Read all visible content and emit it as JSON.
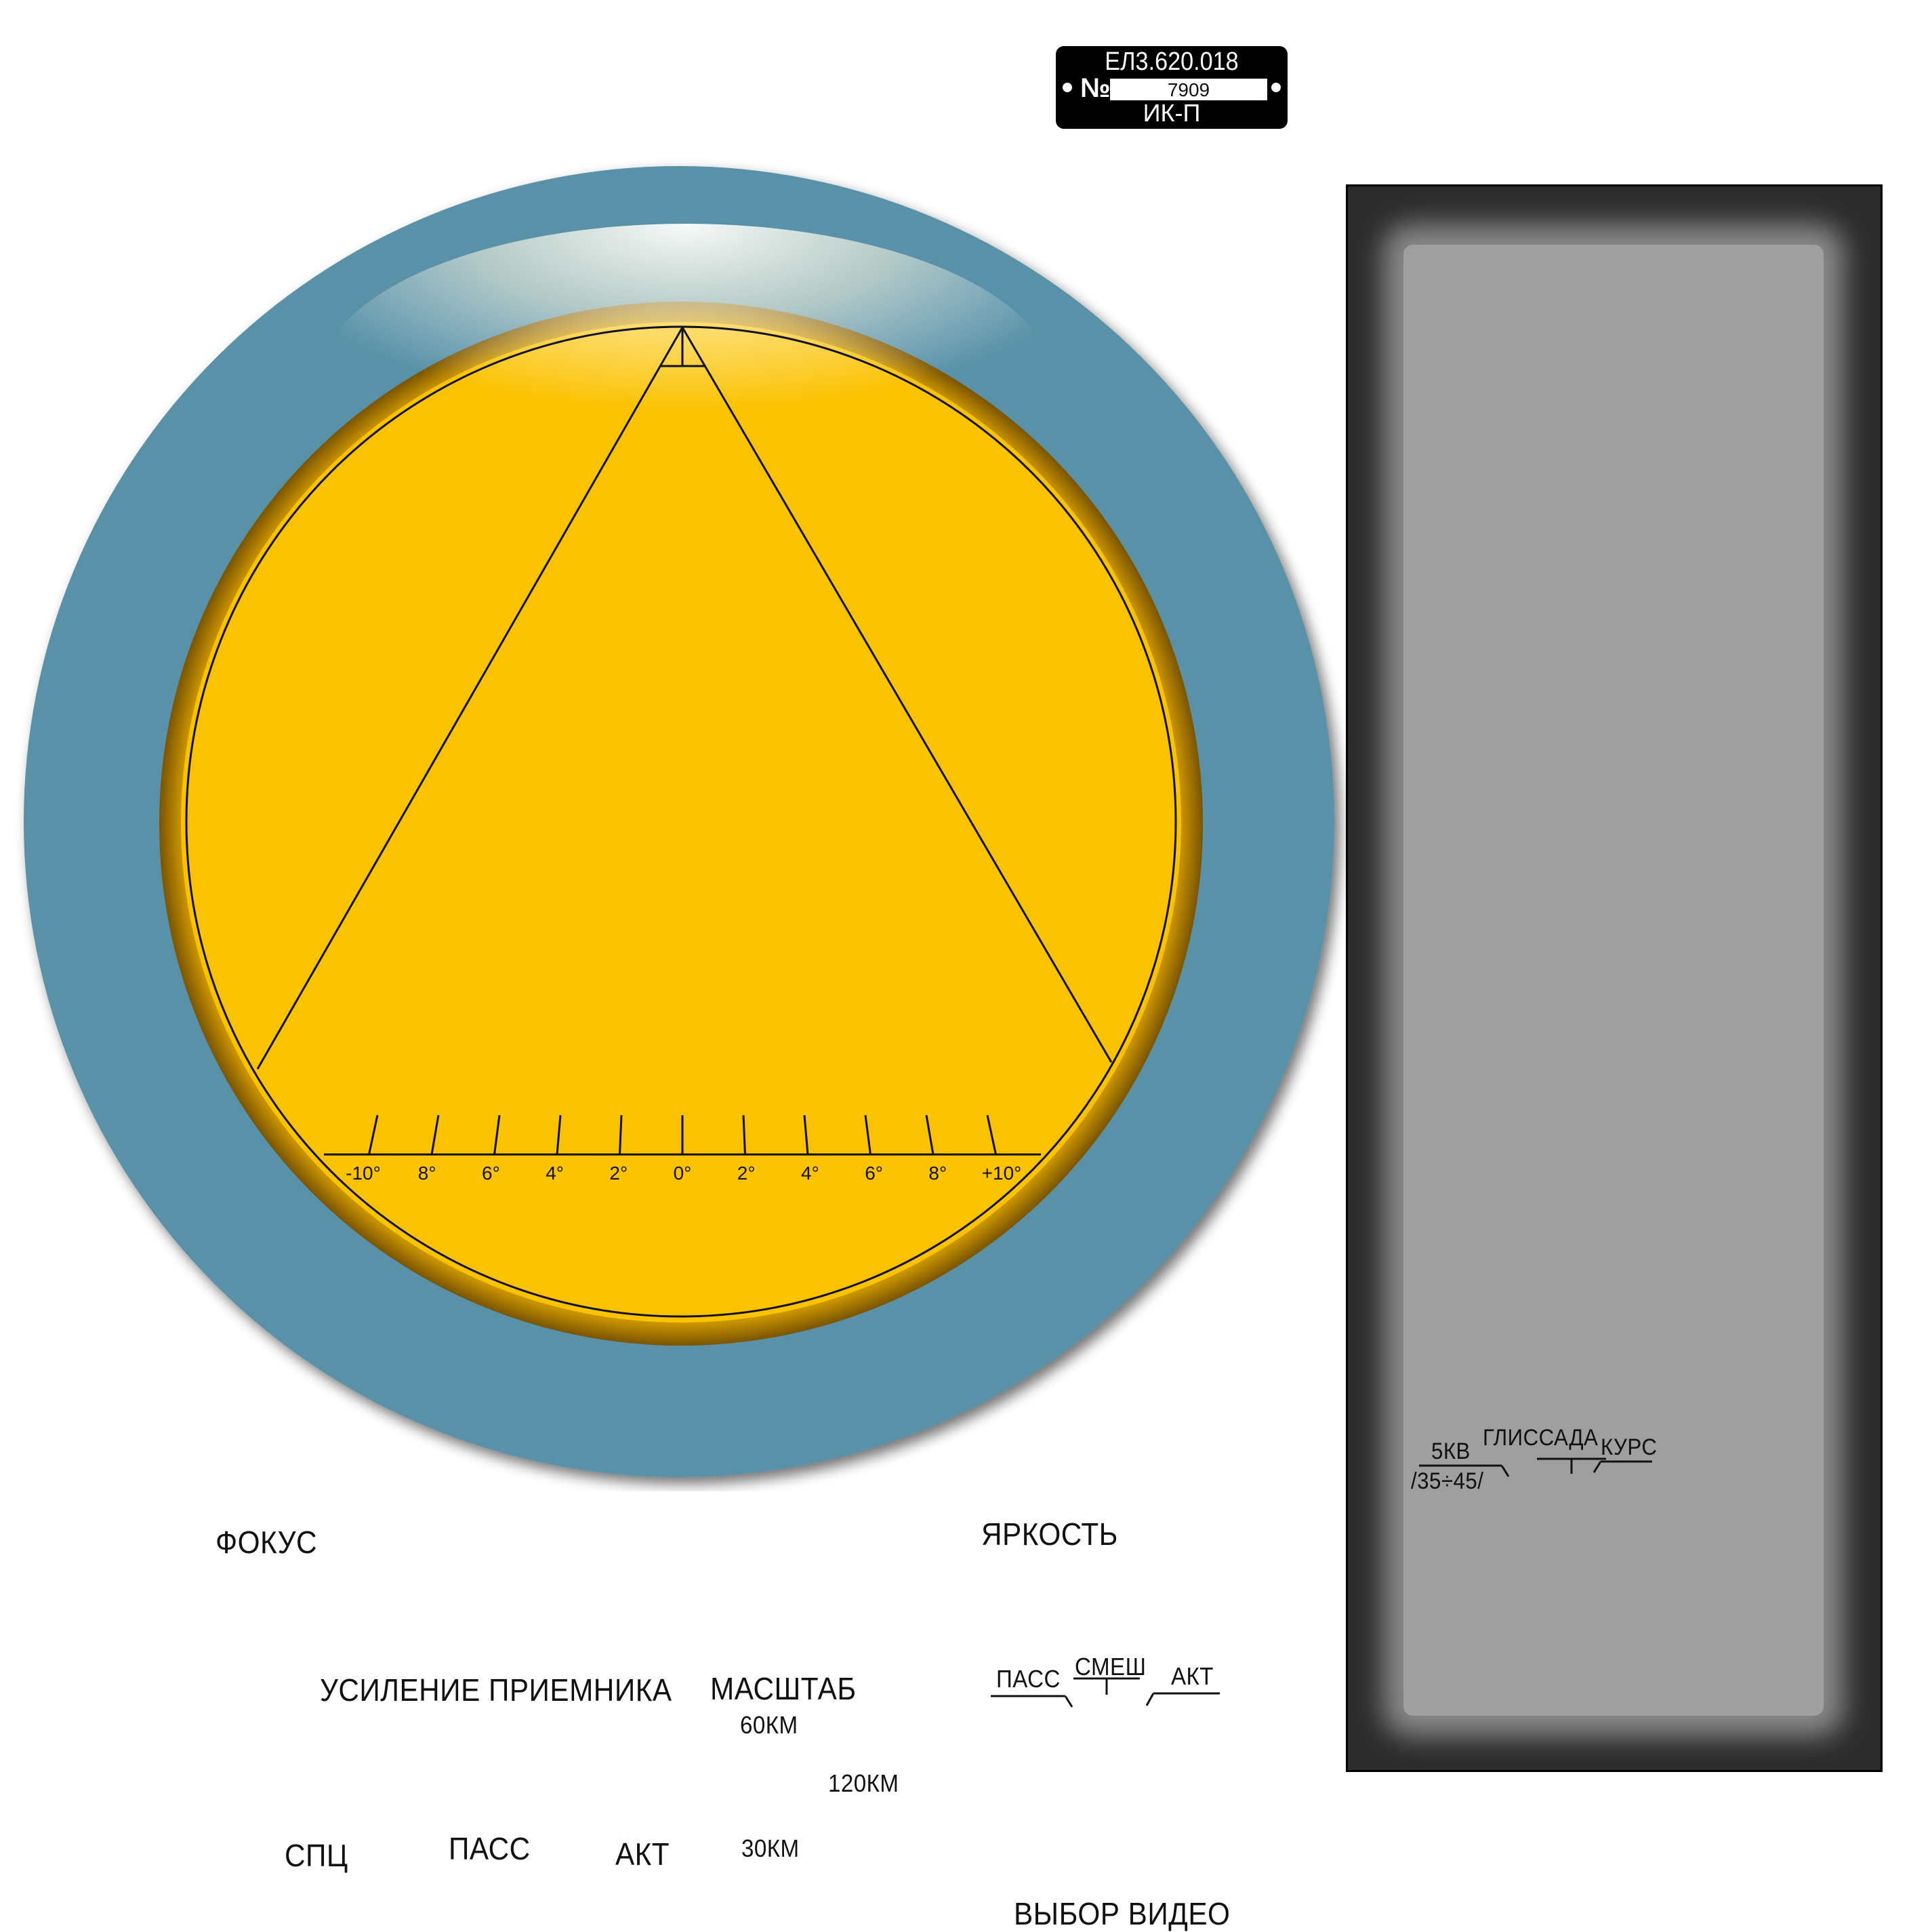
{
  "plate": {
    "code": "ЕЛ3.620.018",
    "number_sign": "№",
    "serial": "7909",
    "model": "ИК-П"
  },
  "screen": {
    "scale_labels": [
      "-10°",
      "8°",
      "6°",
      "4°",
      "2°",
      "0°",
      "2°",
      "4°",
      "6°",
      "8°",
      "+10°"
    ]
  },
  "colors": {
    "bezel": "#5891A8",
    "screen": "#FBC200",
    "panel_outer": "#2c2c2c",
    "panel_inner": "#9f9f9f",
    "plate": "#000000"
  },
  "controls": {
    "focus": "ФОКУС",
    "brightness": "ЯРКОСТЬ",
    "receiver_gain": "УСИЛЕНИЕ  ПРИЕМНИКА",
    "scale": "МАСШТАБ",
    "scale_60": "60КМ",
    "scale_120": "120КМ",
    "scale_30": "30КМ",
    "mode_spc": "СПЦ",
    "mode_pass": "ПАСС",
    "mode_akt": "АКТ",
    "video_select": "ВЫБОР  ВИДЕО",
    "video_pass": "ПАСС",
    "video_mix": "СМЕШ",
    "video_akt": "АКТ"
  },
  "panel": {
    "kv5": "5КВ",
    "kv_range": "/35÷45/",
    "glide": "ГЛИССАДА",
    "course": "КУРС"
  }
}
